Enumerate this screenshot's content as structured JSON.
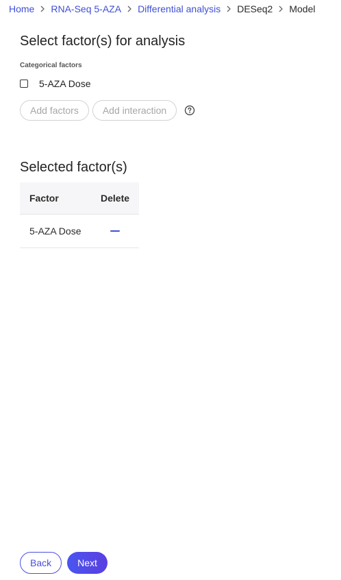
{
  "breadcrumb": {
    "items": [
      {
        "label": "Home",
        "link": true
      },
      {
        "label": "RNA-Seq 5-AZA",
        "link": true
      },
      {
        "label": "Differential analysis",
        "link": true
      },
      {
        "label": "DESeq2",
        "link": false
      },
      {
        "label": "Model",
        "link": false
      }
    ],
    "separator_icon": "chevron-right-icon"
  },
  "select_section": {
    "title": "Select factor(s) for analysis",
    "subtitle": "Categorical factors",
    "factors": [
      {
        "label": "5-AZA Dose",
        "checked": false
      }
    ],
    "add_factors_label": "Add factors",
    "add_interaction_label": "Add interaction",
    "help_icon": "help-circle-icon"
  },
  "selected_section": {
    "title": "Selected factor(s)",
    "columns": [
      "Factor",
      "Delete"
    ],
    "rows": [
      {
        "factor": "5-AZA Dose",
        "delete_icon": "minus-icon"
      }
    ]
  },
  "footer": {
    "back_label": "Back",
    "next_label": "Next"
  },
  "colors": {
    "accent": "#3f4fd8",
    "primary_button": "#4a55f0",
    "header_bg": "#f6f6f8",
    "border": "#e4e4e8"
  }
}
